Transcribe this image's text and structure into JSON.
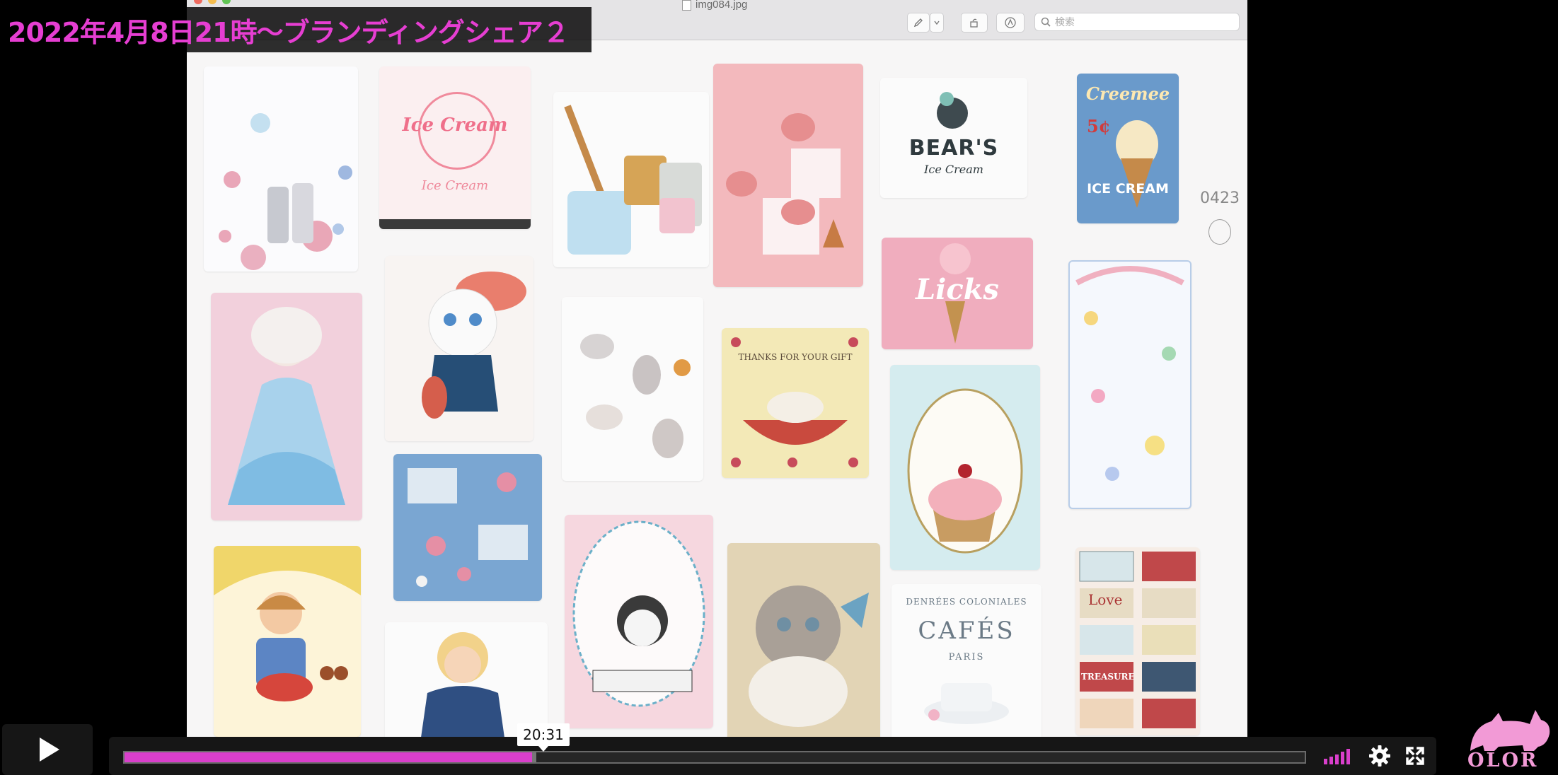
{
  "overlay_title": "2022年4月8日21時〜ブランディングシェア２",
  "viewer": {
    "filename": "img084.jpg",
    "search_placeholder": "検索"
  },
  "moodboard": {
    "tile_ice_cream_logo": "Ice Cream",
    "tile_bears": "BEAR'S",
    "tile_bears_sub": "Ice Cream",
    "tile_creemee_top": "Creemee",
    "tile_creemee_price": "5¢",
    "tile_creemee_bottom": "ICE CREAM",
    "tile_licks": "Licks",
    "tile_thanks": "THANKS FOR YOUR GIFT",
    "tile_cafes_top": "DENRÉES COLONIALES",
    "tile_cafes": "CAFÉS",
    "tile_cafes_paris": "PARIS",
    "tile_tickets_love": "Love",
    "tile_tickets_treasure": "TREASURE",
    "handwriting": "0423"
  },
  "player": {
    "tooltip_time": "20:31",
    "progress_fraction": 0.3455,
    "buffer_fraction": 0.0035,
    "logo_text": "OLOR"
  },
  "colors": {
    "accent": "#d93fcb",
    "overlay_text": "#e63ed2",
    "logo": "#f29ad6"
  },
  "icons": {
    "play": "play-icon",
    "volume": "volume-bars-icon",
    "settings": "gear-icon",
    "fullscreen": "fullscreen-icon",
    "search": "search-icon",
    "logo": "cat-logo-icon"
  }
}
